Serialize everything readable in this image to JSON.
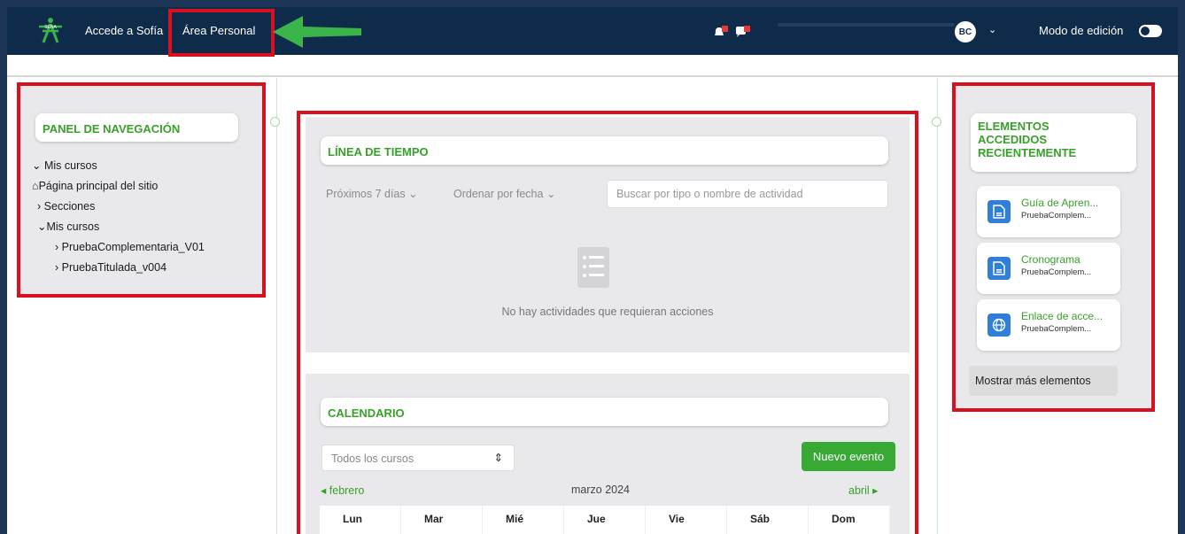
{
  "topbar": {
    "logo_text": "SENA",
    "accede_label": "Accede a Sofía",
    "area_personal_label": "Área Personal",
    "user_initials": "BC",
    "edit_mode_label": "Modo de edición",
    "bell_icon": "bell-icon",
    "chat_icon": "chat-icon"
  },
  "left_panel": {
    "title": "PANEL DE NAVEGACIÓN",
    "items": [
      {
        "label": "Mis cursos",
        "icon": "chevron-down-icon"
      },
      {
        "label": "Página principal del sitio",
        "icon": "home-icon"
      },
      {
        "label": "Secciones",
        "icon": "chevron-right-icon"
      },
      {
        "label": "Mis cursos",
        "icon": "chevron-down-icon"
      },
      {
        "label": "PruebaComplementaria_V01",
        "icon": "chevron-right-icon"
      },
      {
        "label": "PruebaTitulada_v004",
        "icon": "chevron-right-icon"
      }
    ]
  },
  "timeline": {
    "title": "LÍNEA DE TIEMPO",
    "filter_label": "Próximos 7 días",
    "sort_label": "Ordenar por fecha",
    "search_placeholder": "Buscar por tipo o nombre de actividad",
    "empty_message": "No hay actividades que requieran acciones"
  },
  "calendar": {
    "title": "CALENDARIO",
    "course_filter": "Todos los cursos",
    "new_event_label": "Nuevo evento",
    "prev_month": "febrero",
    "current_month": "marzo 2024",
    "next_month": "abril",
    "weekdays": [
      "Lun",
      "Mar",
      "Mié",
      "Jue",
      "Vie",
      "Sáb",
      "Dom"
    ]
  },
  "recent": {
    "title_line1": "ELEMENTOS",
    "title_line2": "ACCEDIDOS",
    "title_line3": "RECIENTEMENTE",
    "items": [
      {
        "title": "Guía de Apren...",
        "course": "PruebaComplem...",
        "icon": "document-icon"
      },
      {
        "title": "Cronograma",
        "course": "PruebaComplem...",
        "icon": "document-icon"
      },
      {
        "title": "Enlace de acce...",
        "course": "PruebaComplem...",
        "icon": "globe-icon"
      }
    ],
    "show_more_label": "Mostrar más elementos"
  },
  "colors": {
    "topbar": "#0f2b4a",
    "accent_green": "#37a12a",
    "highlight_red": "#d8101f",
    "arrow_green": "#3bb54a",
    "icon_blue": "#2f7ed8"
  }
}
